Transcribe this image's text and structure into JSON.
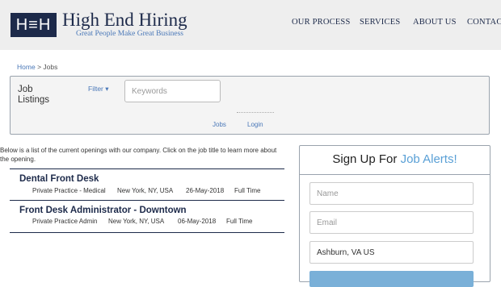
{
  "header": {
    "logo_text": "H≡H",
    "brand_name": "High End Hiring",
    "tagline": "Great People Make Great Business",
    "nav": [
      "OUR PROCESS",
      "SERVICES",
      "ABOUT US",
      "CONTACT"
    ]
  },
  "breadcrumb": {
    "home": "Home",
    "separator": ">",
    "current": "Jobs"
  },
  "filter_panel": {
    "title": "Job Listings",
    "filter_label": "Filter ▾",
    "keywords_placeholder": "Keywords",
    "links": [
      "Jobs",
      "Login"
    ]
  },
  "listing": {
    "intro": "Below is a list of the current openings with our company. Click on the job title to learn more about the opening.",
    "jobs": [
      {
        "title": "Dental Front Desk",
        "company": "Private Practice - Medical",
        "location": "New York, NY, USA",
        "date": "26-May-2018",
        "type": "Full Time"
      },
      {
        "title": "Front Desk Administrator - Downtown",
        "company": "Private Practice Admin",
        "location": "New York, NY, USA",
        "date": "06-May-2018",
        "type": "Full Time"
      }
    ]
  },
  "signup": {
    "heading_prefix": "Sign Up For",
    "heading_accent": "Job Alerts!",
    "name_placeholder": "Name",
    "email_placeholder": "Email",
    "location_value": "Ashburn, VA US"
  },
  "colors": {
    "brand": "#1d2a4a",
    "link": "#4a78b8",
    "accent": "#5aa0d6",
    "button": "#7ab0d8"
  }
}
